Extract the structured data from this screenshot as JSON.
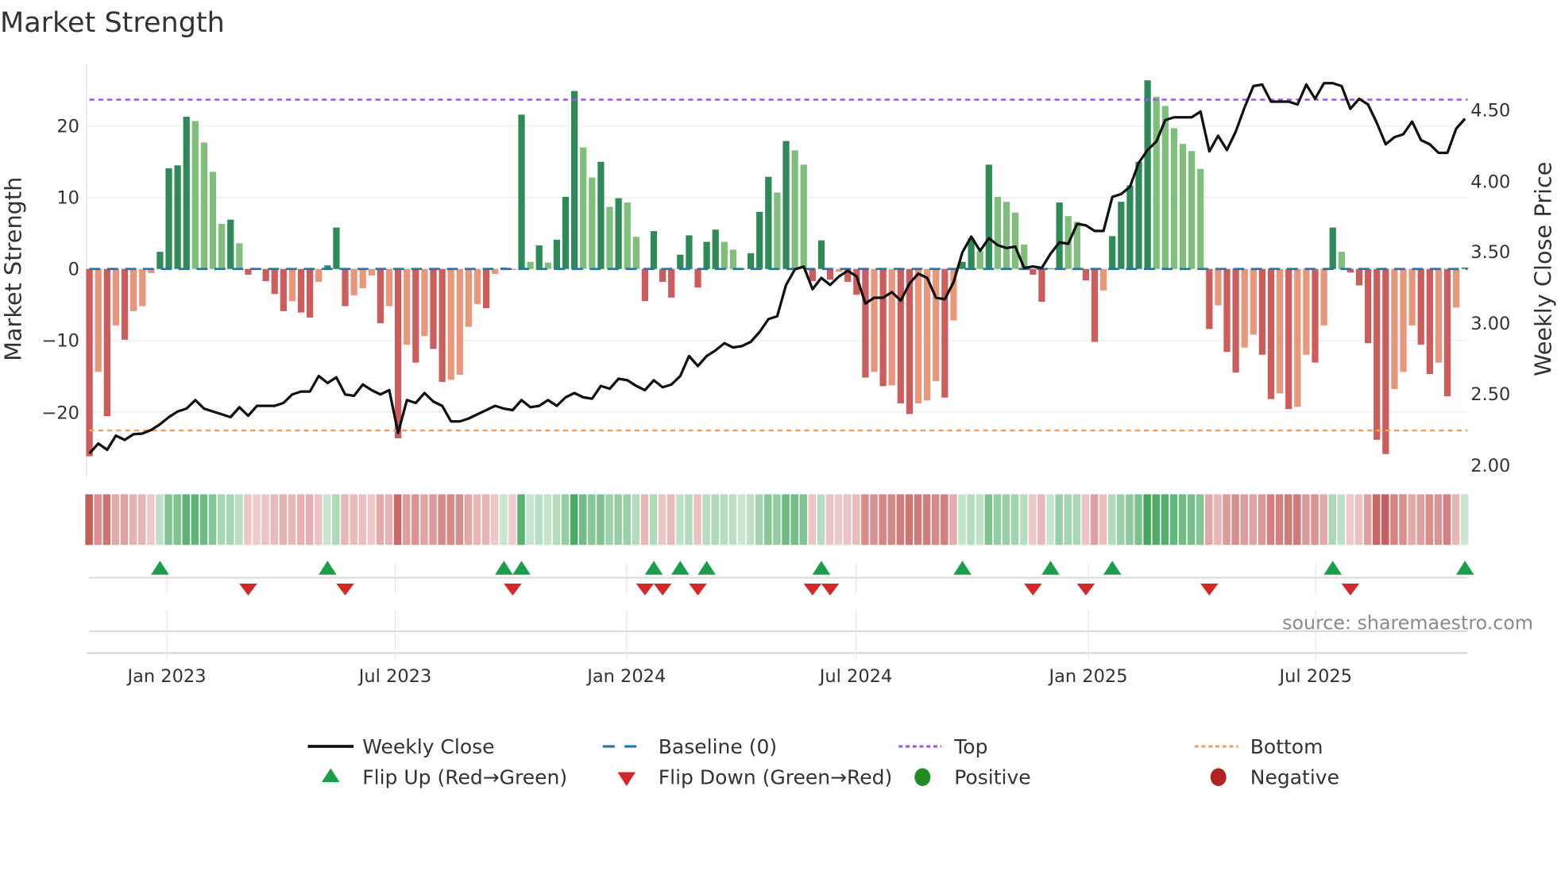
{
  "title": "Market Strength",
  "source": "source: sharemaestro.com",
  "colors": {
    "pos_up": "#2e8b57",
    "pos_down": "#7fbf7b",
    "neg_down": "#cd5c5c",
    "neg_up": "#e9967a",
    "price": "#111111",
    "baseline": "#1f77b4",
    "top": "#9b59e6",
    "bottom": "#f0a060",
    "flip_up": "#1a9e4a",
    "flip_down": "#d62728",
    "positive": "#228b22",
    "negative": "#b22222"
  },
  "chart_data": {
    "type": "bar",
    "title": "Market Strength",
    "ylabel": "Market Strength",
    "ylabel_right": "Weekly Close Price",
    "x_start": "2022-11-04",
    "x_step": "1 week",
    "x_ticks": [
      "Jan 2023",
      "Jul 2023",
      "Jan 2024",
      "Jul 2024",
      "Jan 2025",
      "Jul 2025"
    ],
    "y_ticks": [
      "20",
      "10",
      "0",
      "−10",
      "−20"
    ],
    "y_tick_values": [
      20,
      10,
      0,
      -10,
      -20
    ],
    "y_right_ticks": [
      "4.50",
      "4.00",
      "3.50",
      "3.00",
      "2.50",
      "2.00"
    ],
    "y_right_tick_values": [
      4.5,
      4.0,
      3.5,
      3.0,
      2.5,
      2.0
    ],
    "ylim": [
      -28,
      29
    ],
    "ylim_right": [
      1.95,
      4.85
    ],
    "top_level": 23.7,
    "bottom_level": -22.6,
    "baseline": 0,
    "grid": true,
    "legend_position": "bottom",
    "series": [
      {
        "name": "Market Strength",
        "type": "bar",
        "values": [
          -26.2,
          -14.4,
          -20.6,
          -7.9,
          -9.9,
          -5.9,
          -5.2,
          -0.6,
          2.4,
          14.1,
          14.5,
          21.3,
          20.7,
          17.7,
          13.6,
          6.3,
          6.9,
          3.6,
          -0.8,
          -0.1,
          -1.7,
          -3.5,
          -5.9,
          -4.5,
          -6.1,
          -6.8,
          -1.8,
          0.5,
          5.8,
          -5.2,
          -3.7,
          -2.7,
          -0.9,
          -7.6,
          -5.2,
          -23.7,
          -10.6,
          -13.1,
          -9.4,
          -11.2,
          -15.8,
          -15.5,
          -14.8,
          -8.1,
          -4.9,
          -5.5,
          -0.7,
          0.2,
          -0.1,
          21.6,
          1.0,
          3.3,
          0.9,
          4.1,
          10.1,
          24.9,
          17.0,
          12.8,
          15.0,
          8.7,
          9.9,
          9.3,
          4.5,
          -4.5,
          5.3,
          -1.8,
          -4.0,
          2.0,
          4.7,
          -2.6,
          3.8,
          5.5,
          3.8,
          2.7,
          0.1,
          2.2,
          8.0,
          12.9,
          10.7,
          17.9,
          16.6,
          14.6,
          -1.7,
          4.0,
          -1.5,
          -0.4,
          -1.8,
          -3.6,
          -15.2,
          -14.4,
          -16.4,
          -16.3,
          -18.8,
          -20.3,
          -18.8,
          -18.4,
          -15.7,
          -18.0,
          -7.2,
          1.0,
          4.3,
          2.5,
          14.6,
          10.1,
          9.4,
          7.9,
          3.4,
          -0.8,
          -4.6,
          0.1,
          9.3,
          7.4,
          6.6,
          -1.6,
          -10.2,
          -3.0,
          4.6,
          9.4,
          11.7,
          15.0,
          26.4,
          24.1,
          22.8,
          19.7,
          17.5,
          16.5,
          14.0,
          -8.4,
          -5.1,
          -11.6,
          -14.5,
          -11.0,
          -9.2,
          -12.0,
          -18.2,
          -17.4,
          -19.6,
          -19.3,
          -12.0,
          -13.1,
          -7.9,
          5.8,
          2.4,
          -0.5,
          -2.3,
          -10.4,
          -23.9,
          -25.9,
          -16.8,
          -14.4,
          -7.9,
          -10.6,
          -14.7,
          -13.1,
          -17.8,
          -5.4,
          0.2
        ]
      },
      {
        "name": "Weekly Close",
        "type": "line",
        "axis": "right",
        "values": [
          2.085,
          2.154,
          2.11,
          2.21,
          2.18,
          2.22,
          2.225,
          2.25,
          2.29,
          2.34,
          2.38,
          2.4,
          2.46,
          2.4,
          2.38,
          2.36,
          2.34,
          2.41,
          2.35,
          2.42,
          2.42,
          2.42,
          2.44,
          2.5,
          2.52,
          2.52,
          2.63,
          2.58,
          2.62,
          2.5,
          2.49,
          2.57,
          2.53,
          2.5,
          2.53,
          2.23,
          2.46,
          2.44,
          2.51,
          2.45,
          2.42,
          2.31,
          2.31,
          2.33,
          2.36,
          2.39,
          2.42,
          2.4,
          2.39,
          2.46,
          2.41,
          2.42,
          2.46,
          2.42,
          2.48,
          2.51,
          2.48,
          2.47,
          2.56,
          2.54,
          2.61,
          2.6,
          2.56,
          2.53,
          2.6,
          2.55,
          2.57,
          2.63,
          2.77,
          2.7,
          2.77,
          2.81,
          2.86,
          2.83,
          2.84,
          2.87,
          2.94,
          3.03,
          3.05,
          3.27,
          3.38,
          3.4,
          3.24,
          3.32,
          3.27,
          3.33,
          3.37,
          3.33,
          3.14,
          3.18,
          3.18,
          3.22,
          3.16,
          3.28,
          3.35,
          3.32,
          3.18,
          3.17,
          3.29,
          3.5,
          3.61,
          3.51,
          3.6,
          3.55,
          3.53,
          3.54,
          3.39,
          3.4,
          3.39,
          3.49,
          3.57,
          3.56,
          3.7,
          3.69,
          3.65,
          3.65,
          3.89,
          3.91,
          3.96,
          4.13,
          4.22,
          4.28,
          4.43,
          4.45,
          4.45,
          4.45,
          4.49,
          4.21,
          4.32,
          4.22,
          4.35,
          4.52,
          4.67,
          4.68,
          4.56,
          4.56,
          4.56,
          4.54,
          4.68,
          4.58,
          4.69,
          4.69,
          4.67,
          4.51,
          4.58,
          4.54,
          4.41,
          4.26,
          4.31,
          4.33,
          4.42,
          4.29,
          4.26,
          4.2,
          4.2,
          4.37,
          4.44
        ]
      }
    ]
  },
  "legend": [
    {
      "label": "Weekly Close",
      "symbol": "line"
    },
    {
      "label": "Baseline (0)",
      "symbol": "dash"
    },
    {
      "label": "Top",
      "symbol": "dot-purple"
    },
    {
      "label": "Bottom",
      "symbol": "dot-orange"
    },
    {
      "label": "Flip Up (Red→Green)",
      "symbol": "triangle-up"
    },
    {
      "label": "Flip Down (Green→Red)",
      "symbol": "triangle-down"
    },
    {
      "label": "Positive",
      "symbol": "circle-green"
    },
    {
      "label": "Negative",
      "symbol": "circle-red"
    }
  ]
}
